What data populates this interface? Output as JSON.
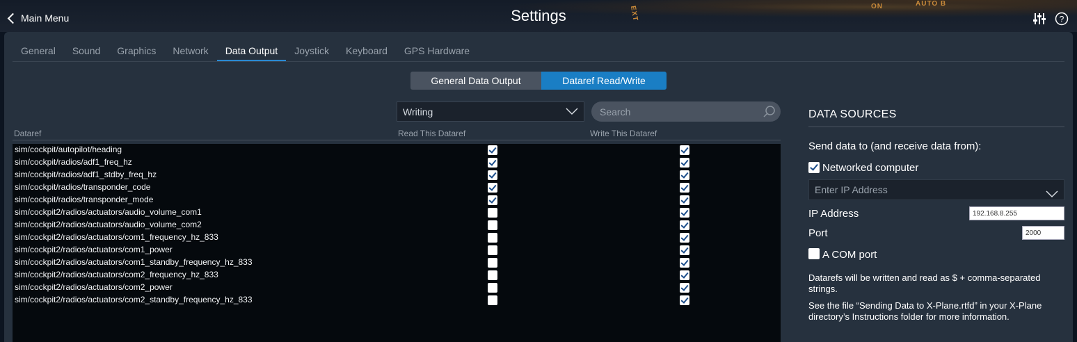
{
  "header": {
    "back_label": "Main Menu",
    "title": "Settings",
    "deco_labels": [
      "ON",
      "AUTO B",
      "EXT"
    ]
  },
  "tabs": [
    {
      "label": "General",
      "active": false
    },
    {
      "label": "Sound",
      "active": false
    },
    {
      "label": "Graphics",
      "active": false
    },
    {
      "label": "Network",
      "active": false
    },
    {
      "label": "Data Output",
      "active": true
    },
    {
      "label": "Joystick",
      "active": false
    },
    {
      "label": "Keyboard",
      "active": false
    },
    {
      "label": "GPS Hardware",
      "active": false
    }
  ],
  "segments": {
    "general_label": "General Data Output",
    "dataref_label": "Dataref Read/Write",
    "selected": "Dataref Read/Write"
  },
  "filter": {
    "mode_value": "Writing",
    "search_placeholder": "Search"
  },
  "columns": {
    "dataref": "Dataref",
    "read": "Read This Dataref",
    "write": "Write This Dataref"
  },
  "datarefs": [
    {
      "name": "sim/cockpit/autopilot/heading",
      "read": true,
      "write": true
    },
    {
      "name": "sim/cockpit/radios/adf1_freq_hz",
      "read": true,
      "write": true
    },
    {
      "name": "sim/cockpit/radios/adf1_stdby_freq_hz",
      "read": true,
      "write": true
    },
    {
      "name": "sim/cockpit/radios/transponder_code",
      "read": true,
      "write": true
    },
    {
      "name": "sim/cockpit/radios/transponder_mode",
      "read": true,
      "write": true
    },
    {
      "name": "sim/cockpit2/radios/actuators/audio_volume_com1",
      "read": false,
      "write": true
    },
    {
      "name": "sim/cockpit2/radios/actuators/audio_volume_com2",
      "read": false,
      "write": true
    },
    {
      "name": "sim/cockpit2/radios/actuators/com1_frequency_hz_833",
      "read": false,
      "write": true
    },
    {
      "name": "sim/cockpit2/radios/actuators/com1_power",
      "read": false,
      "write": true
    },
    {
      "name": "sim/cockpit2/radios/actuators/com1_standby_frequency_hz_833",
      "read": false,
      "write": true
    },
    {
      "name": "sim/cockpit2/radios/actuators/com2_frequency_hz_833",
      "read": false,
      "write": true
    },
    {
      "name": "sim/cockpit2/radios/actuators/com2_power",
      "read": false,
      "write": true
    },
    {
      "name": "sim/cockpit2/radios/actuators/com2_standby_frequency_hz_833",
      "read": false,
      "write": true
    }
  ],
  "data_sources": {
    "title": "DATA SOURCES",
    "send_label": "Send data to (and receive data from):",
    "networked_label": "Networked computer",
    "networked_checked": true,
    "ip_select_placeholder": "Enter IP Address",
    "ip_label": "IP Address",
    "ip_value": "192.168.8.255",
    "port_label": "Port",
    "port_value": "2000",
    "com_label": "A COM port",
    "com_checked": false,
    "info_1": "Datarefs will be written and read as $ + comma-separated strings.",
    "info_2": "See the file “Sending Data to X-Plane.rtfd” in your X-Plane directory’s Instructions folder for more information."
  },
  "colors": {
    "accent": "#1a7ec4",
    "panel": "#26313e",
    "list_bg": "#05090d"
  }
}
